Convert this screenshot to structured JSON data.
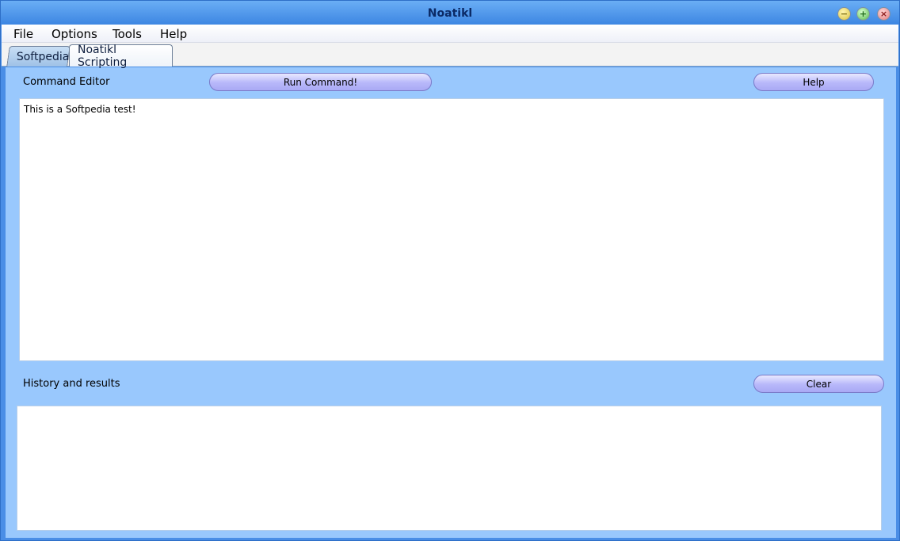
{
  "window": {
    "title": "Noatikl",
    "buttons": [
      {
        "name": "minimize",
        "glyph": "−"
      },
      {
        "name": "maximize",
        "glyph": "+"
      },
      {
        "name": "close",
        "glyph": "×"
      }
    ]
  },
  "menubar": {
    "items": [
      "File",
      "Options",
      "Tools",
      "Help"
    ]
  },
  "tabs": [
    {
      "label": "Softpedia",
      "active": false
    },
    {
      "label": "Noatikl Scripting",
      "active": true
    }
  ],
  "command_editor": {
    "label": "Command Editor",
    "run_button": "Run Command!",
    "help_button": "Help",
    "content": "This is a Softpedia test!"
  },
  "history": {
    "label": "History and results",
    "clear_button": "Clear",
    "content": ""
  },
  "colors": {
    "panel_background": "#99c8fd",
    "button_fill": "#b8b8fa",
    "window_frame": "#4a8ee6"
  }
}
